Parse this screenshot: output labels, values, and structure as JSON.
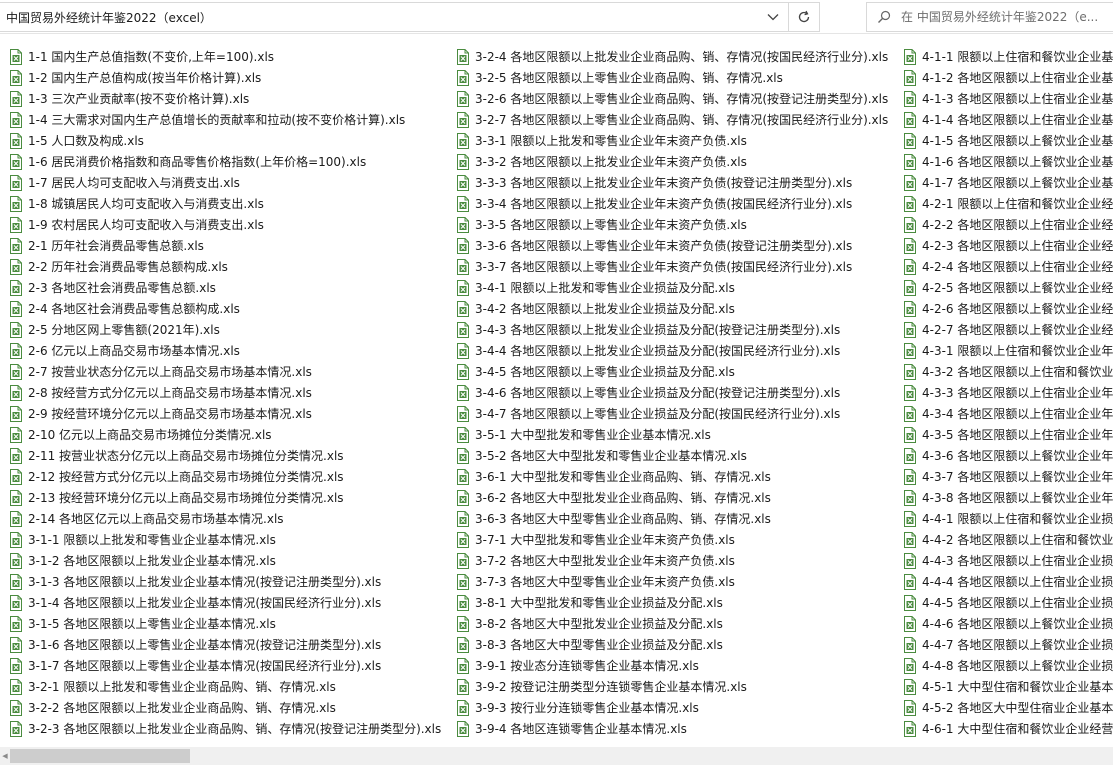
{
  "address_bar": {
    "path": "中国贸易外经统计年鉴2022（excel）",
    "dropdown_icon": "chevron-down-icon",
    "refresh_icon": "refresh-icon"
  },
  "search": {
    "placeholder": "在 中国贸易外经统计年鉴2022（e...",
    "icon": "search-icon"
  },
  "file_icon_color": "#4a8b3f",
  "columns": [
    [
      "1-1 国内生产总值指数(不变价,上年=100).xls",
      "1-2 国内生产总值构成(按当年价格计算).xls",
      "1-3 三次产业贡献率(按不变价格计算).xls",
      "1-4 三大需求对国内生产总值增长的贡献率和拉动(按不变价格计算).xls",
      "1-5 人口数及构成.xls",
      "1-6 居民消费价格指数和商品零售价格指数(上年价格=100).xls",
      "1-7 居民人均可支配收入与消费支出.xls",
      "1-8 城镇居民人均可支配收入与消费支出.xls",
      "1-9 农村居民人均可支配收入与消费支出.xls",
      "2-1 历年社会消费品零售总额.xls",
      "2-2 历年社会消费品零售总额构成.xls",
      "2-3 各地区社会消费品零售总额.xls",
      "2-4 各地区社会消费品零售总额构成.xls",
      "2-5 分地区网上零售额(2021年).xls",
      "2-6 亿元以上商品交易市场基本情况.xls",
      "2-7 按营业状态分亿元以上商品交易市场基本情况.xls",
      "2-8 按经营方式分亿元以上商品交易市场基本情况.xls",
      "2-9 按经营环境分亿元以上商品交易市场基本情况.xls",
      "2-10 亿元以上商品交易市场摊位分类情况.xls",
      "2-11 按营业状态分亿元以上商品交易市场摊位分类情况.xls",
      "2-12 按经营方式分亿元以上商品交易市场摊位分类情况.xls",
      "2-13 按经营环境分亿元以上商品交易市场摊位分类情况.xls",
      "2-14 各地区亿元以上商品交易市场基本情况.xls",
      "3-1-1 限额以上批发和零售业企业基本情况.xls",
      "3-1-2 各地区限额以上批发业企业基本情况.xls",
      "3-1-3 各地区限额以上批发业企业基本情况(按登记注册类型分).xls",
      "3-1-4 各地区限额以上批发业企业基本情况(按国民经济行业分).xls",
      "3-1-5 各地区限额以上零售业企业基本情况.xls",
      "3-1-6 各地区限额以上零售业企业基本情况(按登记注册类型分).xls",
      "3-1-7 各地区限额以上零售业企业基本情况(按国民经济行业分).xls",
      "3-2-1 限额以上批发和零售业企业商品购、销、存情况.xls",
      "3-2-2 各地区限额以上批发业企业商品购、销、存情况.xls",
      "3-2-3 各地区限额以上批发业企业商品购、销、存情况(按登记注册类型分).xls"
    ],
    [
      "3-2-4 各地区限额以上批发业企业商品购、销、存情况(按国民经济行业分).xls",
      "3-2-5 各地区限额以上零售业企业商品购、销、存情况.xls",
      "3-2-6 各地区限额以上零售业企业商品购、销、存情况(按登记注册类型分).xls",
      "3-2-7 各地区限额以上零售业企业商品购、销、存情况(按国民经济行业分).xls",
      "3-3-1 限额以上批发和零售业企业年末资产负债.xls",
      "3-3-2 各地区限额以上批发业企业年末资产负债.xls",
      "3-3-3 各地区限额以上批发业企业年末资产负债(按登记注册类型分).xls",
      "3-3-4 各地区限额以上批发业企业年末资产负债(按国民经济行业分).xls",
      "3-3-5 各地区限额以上零售业企业年末资产负债.xls",
      "3-3-6 各地区限额以上零售业企业年末资产负债(按登记注册类型分).xls",
      "3-3-7 各地区限额以上零售业企业年末资产负债(按国民经济行业分).xls",
      "3-4-1 限额以上批发和零售业企业损益及分配.xls",
      "3-4-2 各地区限额以上批发业企业损益及分配.xls",
      "3-4-3 各地区限额以上批发业企业损益及分配(按登记注册类型分).xls",
      "3-4-4 各地区限额以上批发业企业损益及分配(按国民经济行业分).xls",
      "3-4-5 各地区限额以上零售业企业损益及分配.xls",
      "3-4-6 各地区限额以上零售业企业损益及分配(按登记注册类型分).xls",
      "3-4-7 各地区限额以上零售业企业损益及分配(按国民经济行业分).xls",
      "3-5-1 大中型批发和零售业企业基本情况.xls",
      "3-5-2 各地区大中型批发和零售业企业基本情况.xls",
      "3-6-1 大中型批发和零售业企业商品购、销、存情况.xls",
      "3-6-2 各地区大中型批发业企业商品购、销、存情况.xls",
      "3-6-3 各地区大中型零售业企业商品购、销、存情况.xls",
      "3-7-1 大中型批发和零售业企业年末资产负债.xls",
      "3-7-2 各地区大中型批发业企业年末资产负债.xls",
      "3-7-3 各地区大中型零售业企业年末资产负债.xls",
      "3-8-1 大中型批发和零售业企业损益及分配.xls",
      "3-8-2 各地区大中型批发业企业损益及分配.xls",
      "3-8-3 各地区大中型零售业企业损益及分配.xls",
      "3-9-1 按业态分连锁零售企业基本情况.xls",
      "3-9-2 按登记注册类型分连锁零售企业基本情况.xls",
      "3-9-3 按行业分连锁零售企业基本情况.xls",
      "3-9-4 各地区连锁零售企业基本情况.xls"
    ],
    [
      "4-1-1 限额以上住宿和餐饮业企业基",
      "4-1-2 各地区限额以上住宿业企业基",
      "4-1-3 各地区限额以上住宿业企业基",
      "4-1-4 各地区限额以上住宿业企业基",
      "4-1-5 各地区限额以上餐饮业企业基",
      "4-1-6 各地区限额以上餐饮业企业基",
      "4-1-7 各地区限额以上餐饮业企业基",
      "4-2-1 限额以上住宿和餐饮业企业经",
      "4-2-2 各地区限额以上住宿业企业经",
      "4-2-3 各地区限额以上住宿业企业经",
      "4-2-4 各地区限额以上住宿业企业经",
      "4-2-5 各地区限额以上餐饮业企业经",
      "4-2-6 各地区限额以上餐饮业企业经",
      "4-2-7 各地区限额以上餐饮业企业经",
      "4-3-1 限额以上住宿和餐饮业企业年",
      "4-3-2 各地区限额以上住宿和餐饮业",
      "4-3-3 各地区限额以上住宿业企业年",
      "4-3-4 各地区限额以上住宿业企业年",
      "4-3-5 各地区限额以上住宿业企业年",
      "4-3-6 各地区限额以上餐饮业企业年",
      "4-3-7 各地区限额以上餐饮业企业年",
      "4-3-8 各地区限额以上餐饮业企业年",
      "4-4-1 限额以上住宿和餐饮业企业损",
      "4-4-2 各地区限额以上住宿和餐饮业",
      "4-4-3 各地区限额以上住宿业企业损",
      "4-4-4 各地区限额以上住宿业企业损",
      "4-4-5 各地区限额以上住宿业企业损",
      "4-4-6 各地区限额以上餐饮业企业损",
      "4-4-7 各地区限额以上餐饮业企业损",
      "4-4-8 各地区限额以上餐饮业企业损",
      "4-5-1 大中型住宿和餐饮业企业基本",
      "4-5-2 各地区大中型住宿业企业基本",
      "4-6-1 大中型住宿和餐饮业企业经营"
    ]
  ]
}
